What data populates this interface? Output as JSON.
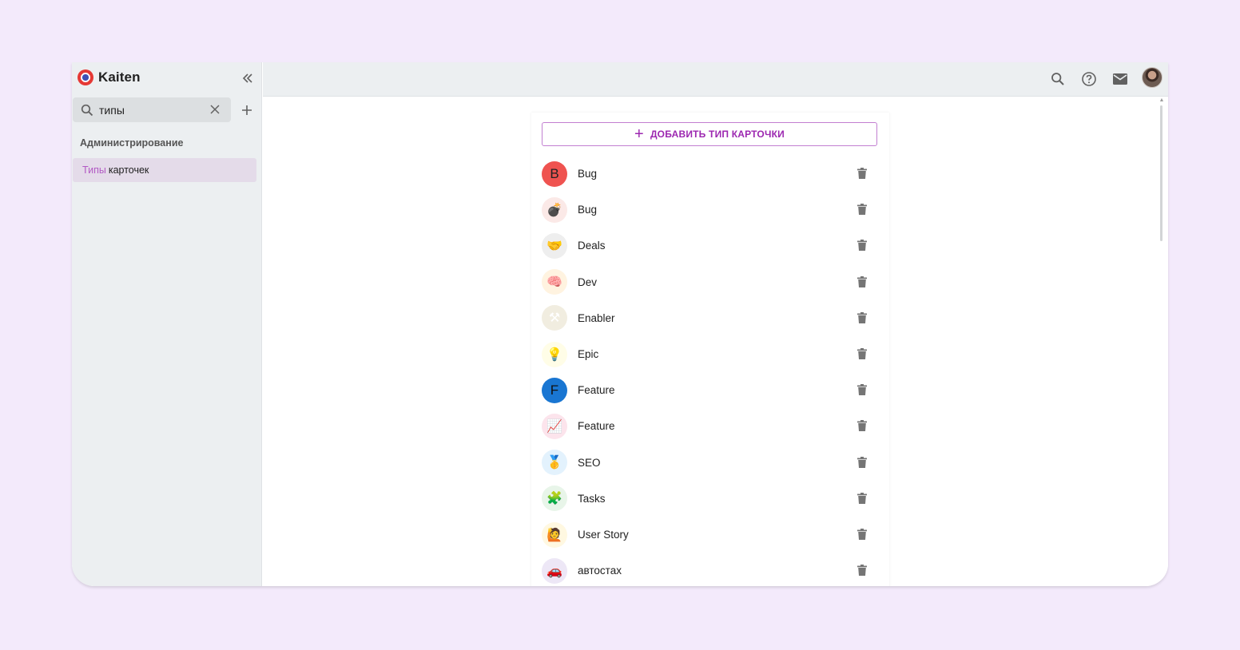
{
  "app": {
    "name": "Kaiten"
  },
  "sidebar": {
    "search": {
      "value": "типы",
      "placeholder": ""
    },
    "section_title": "Администрирование",
    "active_item": {
      "highlight": "Типы",
      "rest": "карточек"
    }
  },
  "main": {
    "add_button_label": "ДОБАВИТЬ ТИП КАРТОЧКИ",
    "card_types": [
      {
        "name": "Bug",
        "icon": "B",
        "icon_type": "letter",
        "bg": "#ef5350"
      },
      {
        "name": "Bug",
        "icon": "💣",
        "icon_type": "emoji",
        "bg": "#fbe9e7"
      },
      {
        "name": "Deals",
        "icon": "🤝",
        "icon_type": "emoji",
        "bg": "#eeeeee"
      },
      {
        "name": "Dev",
        "icon": "🧠",
        "icon_type": "emoji",
        "bg": "#fff3e0"
      },
      {
        "name": "Enabler",
        "icon": "⚒",
        "icon_type": "emoji",
        "bg": "#f1ede0"
      },
      {
        "name": "Epic",
        "icon": "💡",
        "icon_type": "emoji",
        "bg": "#fffde7"
      },
      {
        "name": "Feature",
        "icon": "F",
        "icon_type": "letter",
        "bg": "#1976d2"
      },
      {
        "name": "Feature",
        "icon": "📈",
        "icon_type": "emoji",
        "bg": "#fce4ec"
      },
      {
        "name": "SEO",
        "icon": "🥇",
        "icon_type": "emoji",
        "bg": "#e3f2fd"
      },
      {
        "name": "Tasks",
        "icon": "🧩",
        "icon_type": "emoji",
        "bg": "#e8f5e9"
      },
      {
        "name": "User Story",
        "icon": "🙋",
        "icon_type": "emoji",
        "bg": "#fff8e1"
      },
      {
        "name": "автостах",
        "icon": "🚗",
        "icon_type": "emoji",
        "bg": "#ede7f6"
      }
    ]
  },
  "colors": {
    "accent": "#9c27b0",
    "sidebar_bg": "#eceff1",
    "page_bg": "#f3eafb"
  },
  "icons": {
    "collapse": "double-chevron-left-icon",
    "search": "search-icon",
    "clear": "close-icon",
    "add": "plus-icon",
    "help": "help-circle-icon",
    "mail": "mail-icon",
    "trash": "trash-icon"
  }
}
